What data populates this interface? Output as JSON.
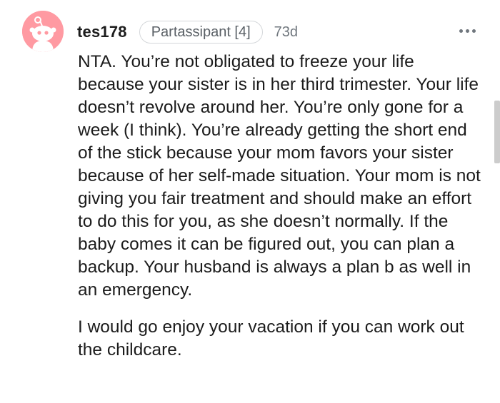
{
  "comment": {
    "author": "tes178",
    "flair": "Partassipant [4]",
    "age": "73d",
    "paragraphs": [
      "NTA. You’re not obligated to freeze your life because your sister is in her third trimester. Your life doesn’t revolve around her. You’re only gone for a week (I think). You’re already getting the short end of the stick because your mom favors your sister because of her self-made situation. Your mom is not giving you fair treatment and should make an effort to do this for you, as she doesn’t normally. If the baby comes it can be figured out, you can plan a backup. Your husband is always a plan b as well in an emergency.",
      "I would go enjoy your vacation if you can work out the childcare."
    ]
  },
  "icons": {
    "avatar": "snoo-avatar-icon",
    "more": "more-options-icon"
  },
  "colors": {
    "avatar_bg": "#ff9aa2",
    "text": "#1c1c1c",
    "muted": "#6f767d"
  }
}
